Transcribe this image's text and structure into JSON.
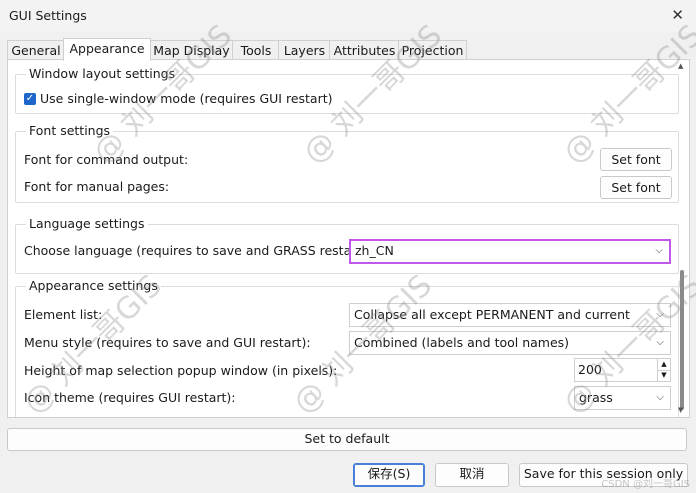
{
  "window": {
    "title": "GUI Settings",
    "close_glyph": "✕"
  },
  "tabs": [
    "General",
    "Appearance",
    "Map Display",
    "Tools",
    "Layers",
    "Attributes",
    "Projection"
  ],
  "active_tab": "Appearance",
  "window_layout": {
    "title": "Window layout settings",
    "single_window_label": "Use single-window mode (requires GUI restart)",
    "single_window_checked": true
  },
  "font_settings": {
    "title": "Font settings",
    "command_output_label": "Font for command output:",
    "manual_pages_label": "Font for manual pages:",
    "set_font_label": "Set font"
  },
  "language_settings": {
    "title": "Language settings",
    "choose_label": "Choose language (requires to save and GRASS restart):",
    "language_value": "zh_CN"
  },
  "appearance_settings": {
    "title": "Appearance settings",
    "element_list_label": "Element list:",
    "element_list_value": "Collapse all except PERMANENT and current",
    "menu_style_label": "Menu style (requires to save and GUI restart):",
    "menu_style_value": "Combined (labels and tool names)",
    "map_popup_label": "Height of map selection popup window (in pixels):",
    "map_popup_value": "200",
    "icon_theme_label": "Icon theme (requires GUI restart):",
    "icon_theme_value": "grass"
  },
  "buttons": {
    "set_default": "Set to default",
    "save": "保存(S)",
    "cancel": "取消",
    "save_session": "Save for this session only"
  },
  "watermark": {
    "text": "@ 刘一哥GIS",
    "corner": "CSDN @刘一哥GIS"
  },
  "icons": {
    "dropdown": "chevron-down-icon",
    "close": "close-icon",
    "check": "check-icon"
  }
}
